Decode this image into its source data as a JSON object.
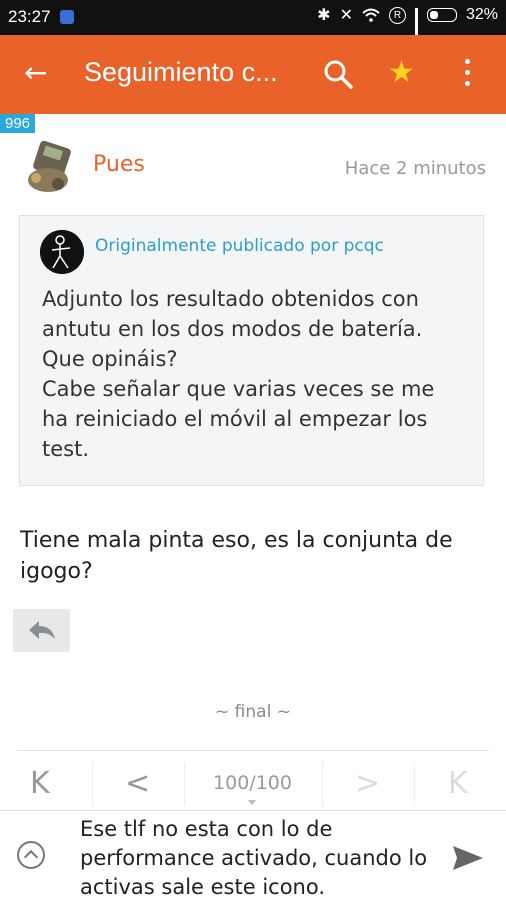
{
  "status_bar": {
    "time": "23:27",
    "battery": "32%"
  },
  "app_bar": {
    "title": "Seguimiento c..."
  },
  "post": {
    "number": "996",
    "author": "Pues",
    "time": "Hace 2 minutos",
    "quote": {
      "attribution": "Originalmente publicado por pcqc",
      "lines": [
        "Adjunto los resultado obtenidos con",
        "antutu en los dos modos de batería.",
        "Que opináis?",
        "Cabe señalar que varias veces se me",
        "ha reiniciado el móvil al empezar los",
        "test."
      ]
    },
    "body": "Tiene mala pinta eso, es la conjunta de igogo?"
  },
  "thread_end": "~ final ~",
  "pager": {
    "first": "K",
    "prev": "<",
    "page_count": "100/100",
    "next": ">",
    "last": "K"
  },
  "composer": {
    "text": "Ese tlf no esta con lo de performance activado, cuando lo activas sale este icono."
  },
  "colors": {
    "accent": "#e8622a",
    "badge": "#2aa8d8",
    "link": "#2aa0c8",
    "star": "#ffd21e"
  }
}
